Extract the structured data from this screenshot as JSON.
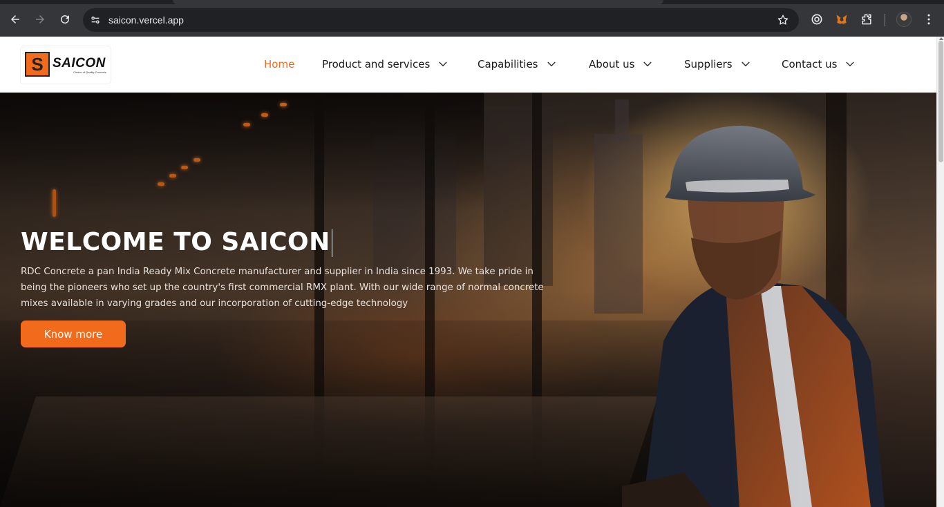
{
  "browser": {
    "url": "saicon.vercel.app"
  },
  "logo": {
    "wordmark": "SAICON",
    "tagline": "Choice of Quality Concrete"
  },
  "nav": {
    "items": [
      {
        "label": "Home",
        "active": true,
        "has_dropdown": false
      },
      {
        "label": "Product and services",
        "active": false,
        "has_dropdown": true
      },
      {
        "label": "Capabilities",
        "active": false,
        "has_dropdown": true
      },
      {
        "label": "About us",
        "active": false,
        "has_dropdown": true
      },
      {
        "label": "Suppliers",
        "active": false,
        "has_dropdown": true
      },
      {
        "label": "Contact us",
        "active": false,
        "has_dropdown": true
      }
    ]
  },
  "hero": {
    "title": "WELCOME TO SAICON",
    "description": "RDC Concrete a pan India Ready Mix Concrete manufacturer and supplier in India since 1993. We take pride in being the pioneers who set up the country's first commercial RMX plant. With our wide range of normal concrete mixes available in varying grades and our incorporation of cutting-edge technology",
    "cta_label": "Know more"
  },
  "colors": {
    "accent": "#f26a1b",
    "header_bg": "#ffffff",
    "chrome_bg": "#35363a"
  }
}
